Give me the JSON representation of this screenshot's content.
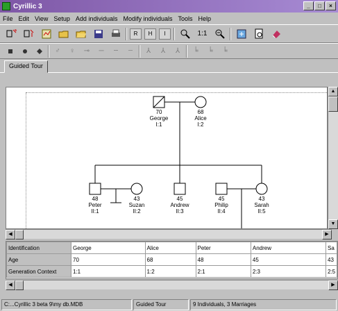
{
  "window": {
    "title": "Cyrillic 3",
    "min": "_",
    "max": "□",
    "close": "×"
  },
  "menu": [
    "File",
    "Edit",
    "View",
    "Setup",
    "Add individuals",
    "Modify individuals",
    "Tools",
    "Help"
  ],
  "toolbar1": [
    "add-male-icon",
    "add-female-icon",
    "chart-icon",
    "open-icon",
    "open-folder-icon",
    "save-icon",
    "print-icon",
    "R",
    "H",
    "I",
    "zoom-icon",
    "1:1",
    "zoom-out-icon",
    "fit-icon",
    "preview-icon",
    "erase-icon"
  ],
  "toolbar2": [
    "square-symbol",
    "circle-symbol",
    "diamond-symbol",
    "male-gender",
    "female-gender",
    "link",
    "line-sym-1",
    "line-sym-2",
    "line-sym-3",
    "child-sym-1",
    "child-sym-2",
    "child-sym-3",
    "twin-sym-1",
    "twin-sym-2",
    "twin-sym-3"
  ],
  "tab": {
    "label": "Guided Tour"
  },
  "pedigree": {
    "george": {
      "age": "70",
      "name": "George",
      "id": "I:1"
    },
    "alice": {
      "age": "68",
      "name": "Alice",
      "id": "I:2"
    },
    "peter": {
      "age": "48",
      "name": "Peter",
      "id": "II:1"
    },
    "suzan": {
      "age": "43",
      "name": "Suzan",
      "id": "II:2"
    },
    "andrew": {
      "age": "45",
      "name": "Andrew",
      "id": "II:3"
    },
    "philip": {
      "age": "45",
      "name": "Philip",
      "id": "II:4"
    },
    "sarah": {
      "age": "43",
      "name": "Sarah",
      "id": "II:5"
    }
  },
  "grid": {
    "row_headers": [
      "Identification",
      "Age",
      "Generation Context"
    ],
    "rows": [
      [
        "George",
        "Alice",
        "Peter",
        "Andrew",
        "Sa"
      ],
      [
        "70",
        "68",
        "48",
        "45",
        "43"
      ],
      [
        "1:1",
        "1:2",
        "2:1",
        "2:3",
        "2:5"
      ]
    ]
  },
  "status": [
    "C:...Cyrillic 3 beta 9\\my db.MDB",
    "Guided Tour",
    "9 Individuals, 3 Marriages"
  ]
}
